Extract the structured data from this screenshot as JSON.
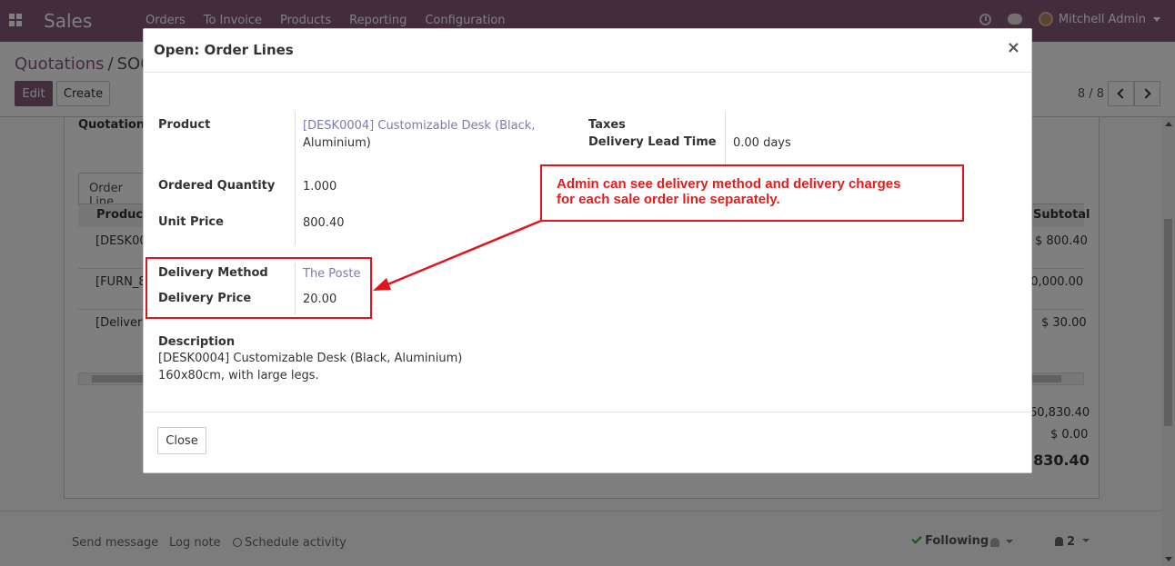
{
  "navbar": {
    "brand": "Sales",
    "menu": [
      "Orders",
      "To Invoice",
      "Products",
      "Reporting",
      "Configuration"
    ],
    "user": "Mitchell Admin"
  },
  "control": {
    "breadcrumb_parent": "Quotations",
    "breadcrumb_sep": "/",
    "breadcrumb_current": "SO0",
    "edit_label": "Edit",
    "create_label": "Create",
    "pager": "8 / 8"
  },
  "background": {
    "quotation_label": "Quotation T",
    "tab_label": "Order Line",
    "col_product": "Product",
    "col_subtotal": "Subtotal",
    "rows": [
      {
        "product": "[DESK00",
        "subtotal": "$ 800.40"
      },
      {
        "product": "[FURN_8",
        "subtotal": "60,000.00"
      },
      {
        "product": "[Delivery",
        "subtotal": "$ 30.00"
      }
    ],
    "untaxed": "60,830.40",
    "taxes": "$ 0.00",
    "total": ",830.40"
  },
  "chatter": {
    "send_message": "Send message",
    "log_note": "Log note",
    "schedule": "Schedule activity",
    "following": "Following",
    "followers": "2"
  },
  "modal": {
    "title": "Open: Order Lines",
    "close_x": "×",
    "product_label": "Product",
    "product_value_1": "[DESK0004] Customizable Desk (Black,",
    "product_value_2": "Aluminium)",
    "ordered_qty_label": "Ordered Quantity",
    "ordered_qty_value": "1.000",
    "unit_price_label": "Unit Price",
    "unit_price_value": "800.40",
    "taxes_label": "Taxes",
    "lead_time_label": "Delivery Lead Time",
    "lead_time_value": "0.00 days",
    "delivery_method_label": "Delivery Method",
    "delivery_method_value": "The Poste",
    "delivery_price_label": "Delivery Price",
    "delivery_price_value": "20.00",
    "description_label": "Description",
    "description_line_1": "[DESK0004] Customizable Desk (Black, Aluminium)",
    "description_line_2": "160x80cm, with large legs.",
    "close_button": "Close"
  },
  "annotation": {
    "line_1": "Admin can see delivery method and delivery charges",
    "line_2": "for each sale order line separately.",
    "color": "#e0141e"
  }
}
